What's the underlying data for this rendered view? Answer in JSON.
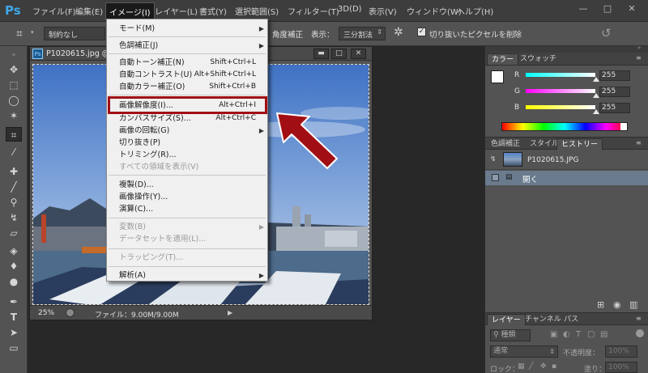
{
  "app": {
    "logo": "Ps"
  },
  "menubar": {
    "items": [
      "ファイル(F)",
      "編集(E)",
      "イメージ(I)",
      "レイヤー(L)",
      "書式(Y)",
      "選択範囲(S)",
      "フィルター(T)",
      "3D(D)",
      "表示(V)",
      "ウィンドウ(W)",
      "ヘルプ(H)"
    ],
    "active_index": 2,
    "window_buttons": [
      "—",
      "□",
      "✕"
    ]
  },
  "options_bar": {
    "ratio_select": "制約なし",
    "angle_label": "角度補正",
    "view_label": "表示：",
    "view_select": "三分割法",
    "delete_cropped_label": "切り抜いたピクセルを削除"
  },
  "document": {
    "badge": "Ps",
    "title": "P1020615.jpg @",
    "zoom": "25%",
    "file_info": "ファイル：9.00M/9.00M"
  },
  "image_menu": {
    "items": [
      {
        "label": "モード(M)",
        "submenu": true
      },
      {
        "label": "色調補正(J)",
        "submenu": true
      },
      {
        "label": "自動トーン補正(N)",
        "shortcut": "Shift+Ctrl+L"
      },
      {
        "label": "自動コントラスト(U)",
        "shortcut": "Alt+Shift+Ctrl+L"
      },
      {
        "label": "自動カラー補正(O)",
        "shortcut": "Shift+Ctrl+B"
      },
      {
        "label": "画像解像度(I)...",
        "shortcut": "Alt+Ctrl+I"
      },
      {
        "label": "カンバスサイズ(S)...",
        "shortcut": "Alt+Ctrl+C"
      },
      {
        "label": "画像の回転(G)",
        "submenu": true
      },
      {
        "label": "切り抜き(P)"
      },
      {
        "label": "トリミング(R)..."
      },
      {
        "label": "すべての領域を表示(V)",
        "disabled": true
      },
      {
        "label": "複製(D)..."
      },
      {
        "label": "画像操作(Y)..."
      },
      {
        "label": "演算(C)..."
      },
      {
        "label": "変数(B)",
        "submenu": true,
        "disabled": true
      },
      {
        "label": "データセットを適用(L)...",
        "disabled": true
      },
      {
        "label": "トラッピング(T)...",
        "disabled": true
      },
      {
        "label": "解析(A)",
        "submenu": true
      }
    ]
  },
  "color_panel": {
    "tabs": [
      "カラー",
      "スウォッチ"
    ],
    "channels": [
      {
        "label": "R",
        "value": "255"
      },
      {
        "label": "G",
        "value": "255"
      },
      {
        "label": "B",
        "value": "255"
      }
    ]
  },
  "history_panel": {
    "tabs": [
      "色調補正",
      "スタイル",
      "ヒストリー"
    ],
    "snapshot": "P1020615.JPG",
    "states": [
      "開く"
    ]
  },
  "layers_panel": {
    "tabs": [
      "レイヤー",
      "チャンネル",
      "パス"
    ],
    "kind_label": "種類",
    "blend_mode": "通常",
    "opacity_label": "不透明度：",
    "opacity_value": "100%",
    "lock_label": "ロック：",
    "fill_label": "塗り：",
    "fill_value": "100%"
  },
  "colors": {
    "accent_highlight": "#a10f14",
    "arrow": "#a10f14",
    "ps_blue": "#3da7e8"
  }
}
